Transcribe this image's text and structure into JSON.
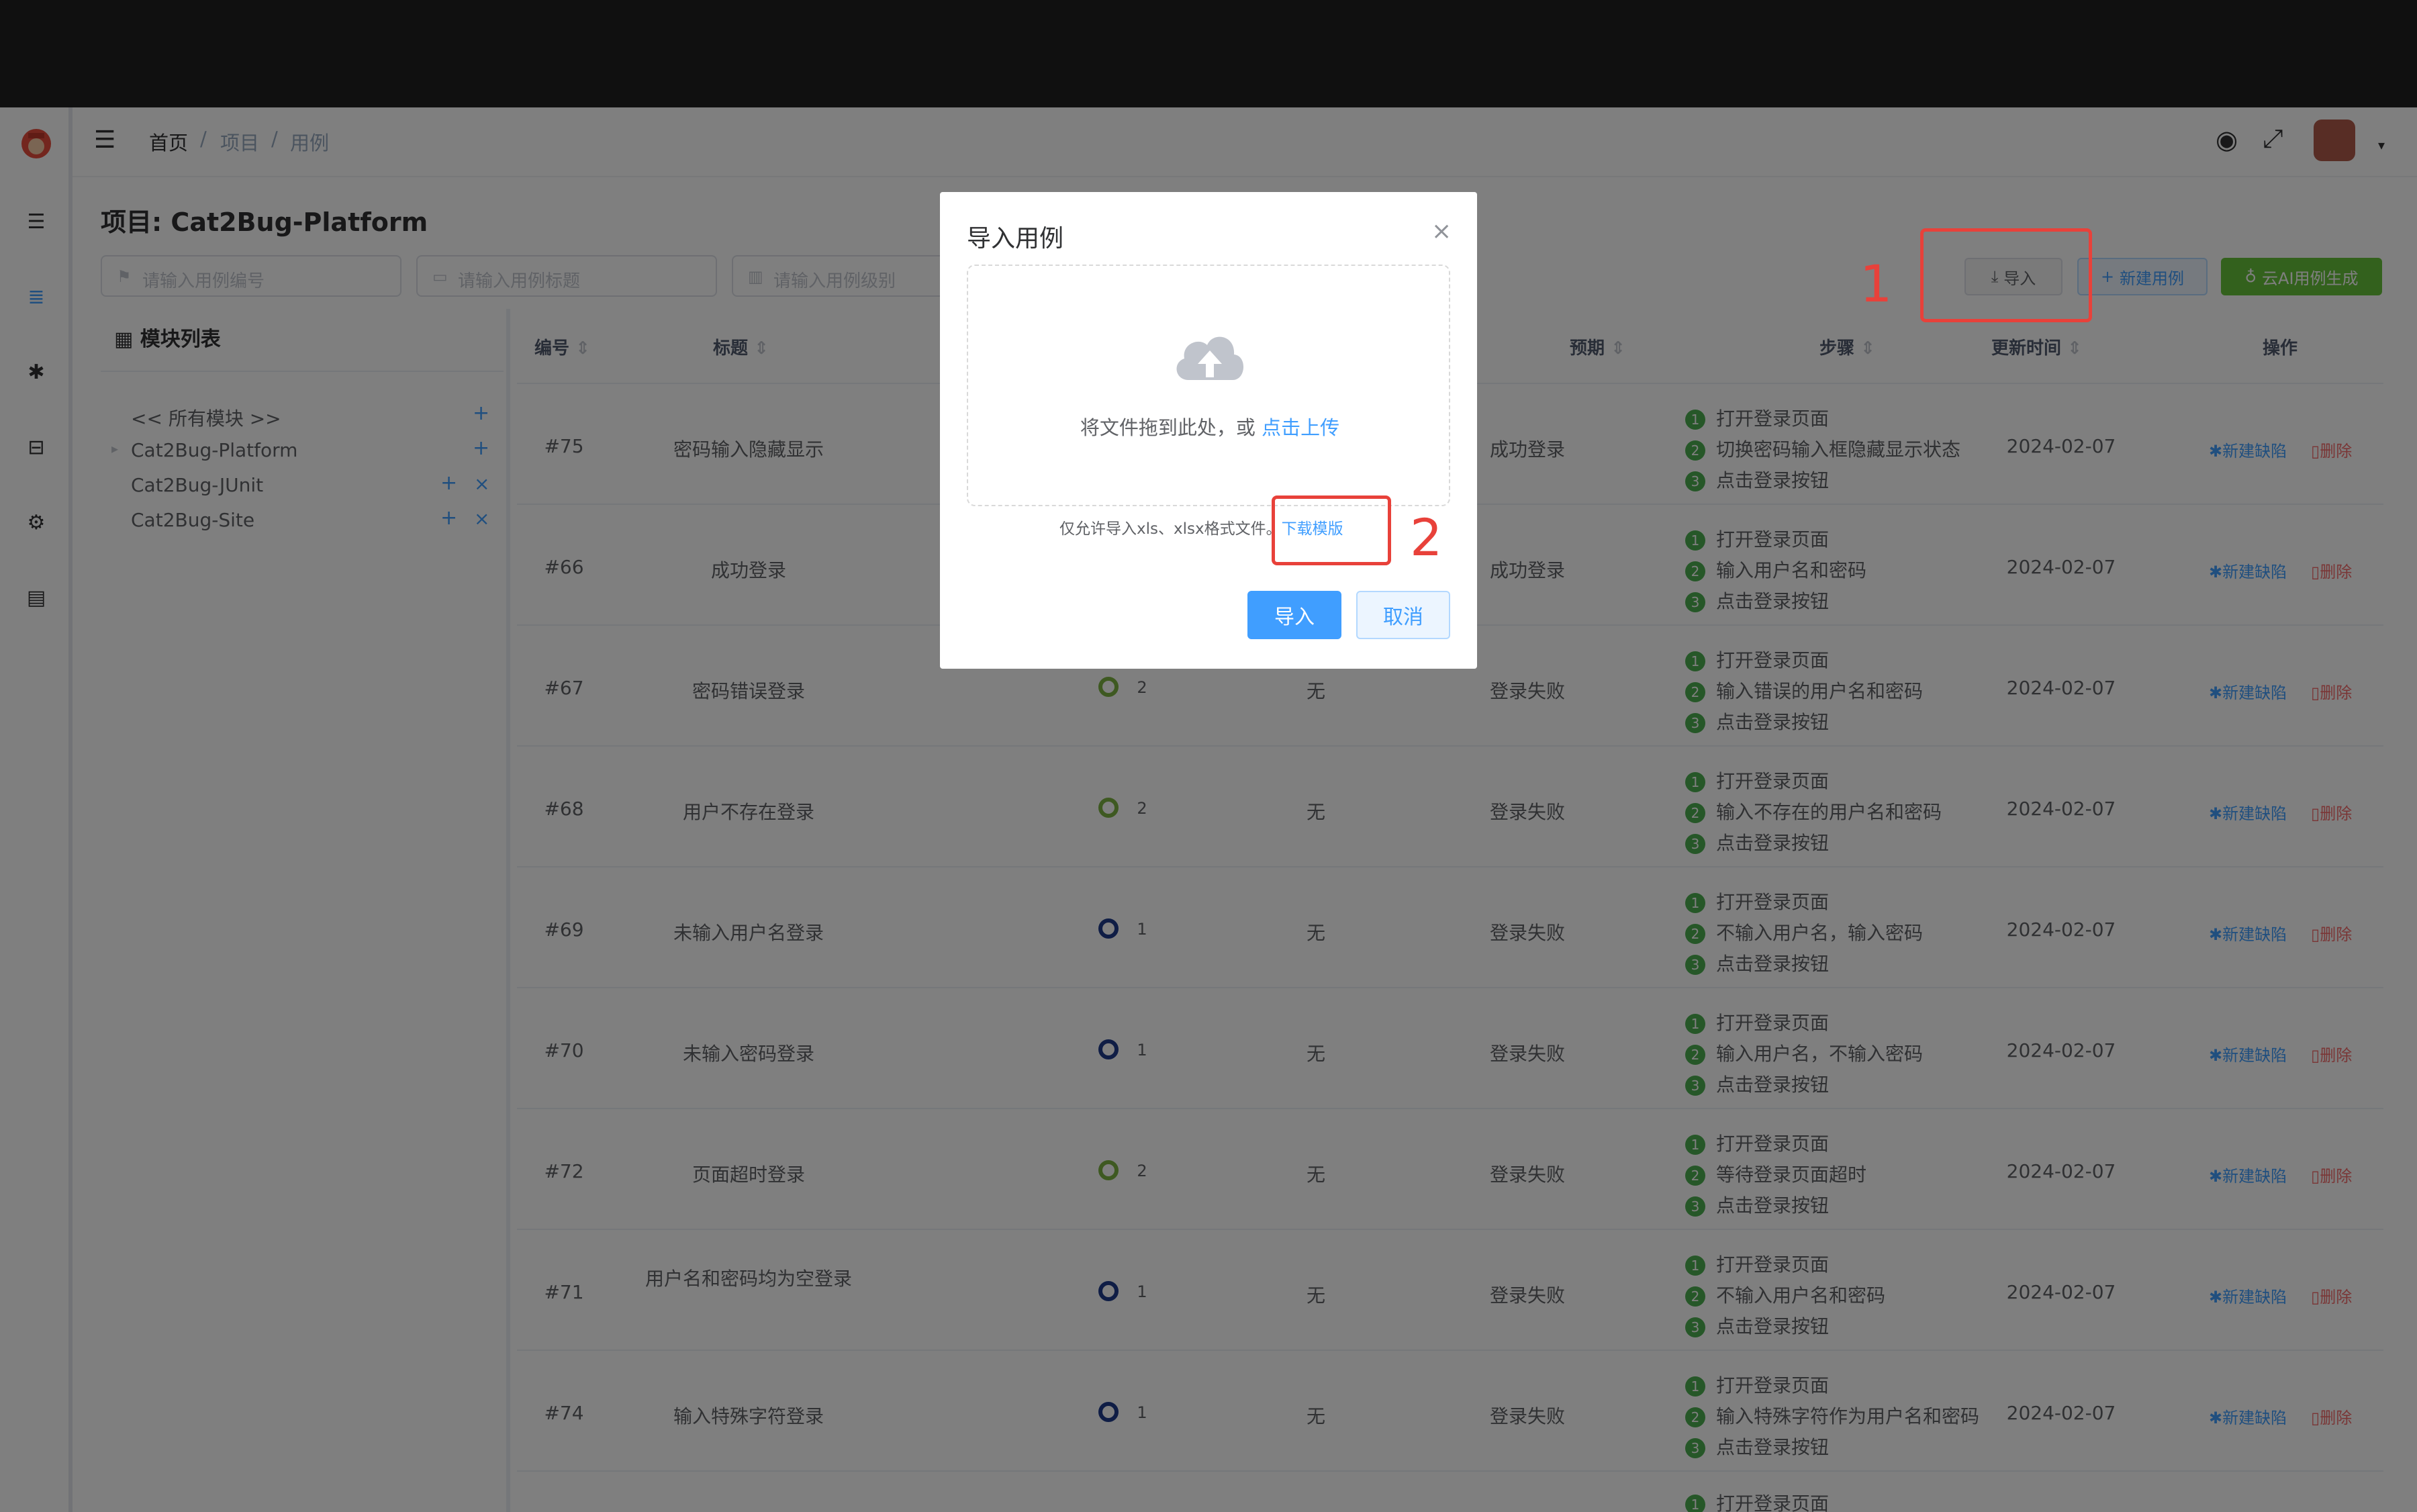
{
  "breadcrumb": [
    "首页",
    "项目",
    "用例"
  ],
  "project_title": "项目: Cat2Bug-Platform",
  "filters": {
    "case_no_placeholder": "请输入用例编号",
    "case_title_placeholder": "请输入用例标题",
    "case_level_placeholder": "请输入用例级别"
  },
  "toolbar": {
    "import_label": "导入",
    "new_case_label": "新建用例",
    "ai_label": "云AI用例生成"
  },
  "modules": {
    "header": "模块列表",
    "items": [
      {
        "label": "<< 所有模块 >>"
      },
      {
        "label": "Cat2Bug-Platform"
      },
      {
        "label": "Cat2Bug-JUnit"
      },
      {
        "label": "Cat2Bug-Site"
      }
    ]
  },
  "table": {
    "headers": [
      "编号",
      "标题",
      "预期",
      "步骤",
      "更新时间",
      "操作"
    ],
    "rows": [
      {
        "id": "#75",
        "title": "密码输入隐藏显示",
        "level": "",
        "pre": "",
        "expect": "成功登录",
        "steps": [
          "打开登录页面",
          "切换密码输入框隐藏显示状态",
          "点击登录按钮"
        ],
        "time": "2024-02-07"
      },
      {
        "id": "#66",
        "title": "成功登录",
        "level": "",
        "pre": "",
        "expect": "成功登录",
        "steps": [
          "打开登录页面",
          "输入用户名和密码",
          "点击登录按钮"
        ],
        "time": "2024-02-07"
      },
      {
        "id": "#67",
        "title": "密码错误登录",
        "level": "2",
        "pre": "无",
        "expect": "登录失败",
        "steps": [
          "打开登录页面",
          "输入错误的用户名和密码",
          "点击登录按钮"
        ],
        "time": "2024-02-07"
      },
      {
        "id": "#68",
        "title": "用户不存在登录",
        "level": "2",
        "pre": "无",
        "expect": "登录失败",
        "steps": [
          "打开登录页面",
          "输入不存在的用户名和密码",
          "点击登录按钮"
        ],
        "time": "2024-02-07"
      },
      {
        "id": "#69",
        "title": "未输入用户名登录",
        "level": "1",
        "pre": "无",
        "expect": "登录失败",
        "steps": [
          "打开登录页面",
          "不输入用户名，输入密码",
          "点击登录按钮"
        ],
        "time": "2024-02-07"
      },
      {
        "id": "#70",
        "title": "未输入密码登录",
        "level": "1",
        "pre": "无",
        "expect": "登录失败",
        "steps": [
          "打开登录页面",
          "输入用户名，不输入密码",
          "点击登录按钮"
        ],
        "time": "2024-02-07"
      },
      {
        "id": "#72",
        "title": "页面超时登录",
        "level": "2",
        "pre": "无",
        "expect": "登录失败",
        "steps": [
          "打开登录页面",
          "等待登录页面超时",
          "点击登录按钮"
        ],
        "time": "2024-02-07"
      },
      {
        "id": "#71",
        "title": "用户名和密码均为空登录",
        "level": "1",
        "pre": "无",
        "expect": "登录失败",
        "steps": [
          "打开登录页面",
          "不输入用户名和密码",
          "点击登录按钮"
        ],
        "time": "2024-02-07"
      },
      {
        "id": "#74",
        "title": "输入特殊字符登录",
        "level": "1",
        "pre": "无",
        "expect": "登录失败",
        "steps": [
          "打开登录页面",
          "输入特殊字符作为用户名和密码",
          "点击登录按钮"
        ],
        "time": "2024-02-07"
      }
    ],
    "partial_step": "打开登录页面",
    "action_new_bug": "新建缺陷",
    "action_delete": "删除"
  },
  "dialog": {
    "title": "导入用例",
    "drop_text": "将文件拖到此处，或 ",
    "drop_link": "点击上传",
    "tip_text": "仅允许导入xls、xlsx格式文件。",
    "tip_link": "下载模版",
    "confirm_label": "导入",
    "cancel_label": "取消"
  },
  "annotations": {
    "one": "1",
    "two": "2"
  },
  "colors": {
    "primary": "#409eff",
    "success": "#4caf50",
    "danger": "#f56c6c",
    "annotation": "#e8413a"
  }
}
